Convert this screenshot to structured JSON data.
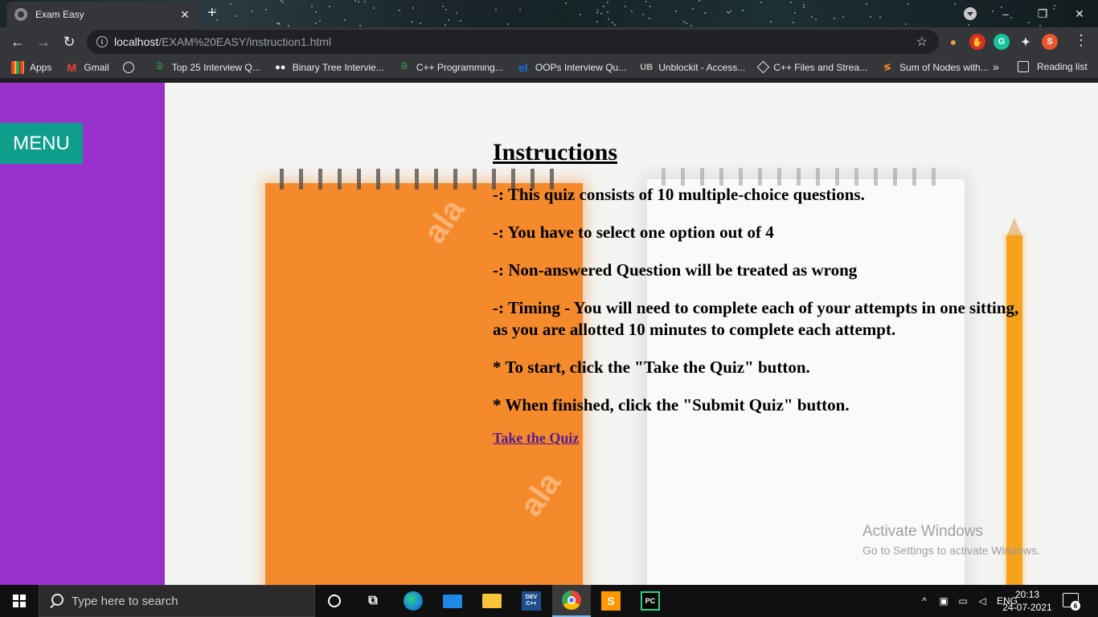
{
  "browser": {
    "tab": {
      "title": "Exam Easy",
      "favicon": "globe-icon"
    },
    "new_tab_label": "+",
    "window_controls": {
      "minimize": "–",
      "maximize": "❐",
      "close": "✕"
    },
    "nav": {
      "back": "←",
      "forward": "→",
      "reload": "↻"
    },
    "address": {
      "host": "localhost",
      "path": "/EXAM%20EASY/instruction1.html"
    },
    "profile_initial": "S",
    "extensions": [
      "G"
    ],
    "bookmarks": [
      {
        "label": "Apps",
        "icon": "apps-grid-icon"
      },
      {
        "label": "Gmail",
        "icon": "gmail-icon"
      },
      {
        "label": "",
        "icon": "globe-icon"
      },
      {
        "label": "Top 25 Interview Q...",
        "icon": "gfg-icon"
      },
      {
        "label": "Binary Tree Intervie...",
        "icon": "medium-icon"
      },
      {
        "label": "C++ Programming...",
        "icon": "gfg-icon"
      },
      {
        "label": "OOPs Interview Qu...",
        "icon": "el-icon"
      },
      {
        "label": "Unblockit - Access...",
        "icon": "ub-icon"
      },
      {
        "label": "C++ Files and Strea...",
        "icon": "tutorialspoint-icon"
      },
      {
        "label": "Sum of Nodes with...",
        "icon": "stackoverflow-icon"
      }
    ],
    "bookmarks_more": "»",
    "reading_list": "Reading list"
  },
  "page": {
    "menu_label": "MENU",
    "title": "Instructions",
    "lines": [
      "-: This quiz consists of 10 multiple-choice questions.",
      "-: You have to select one option out of 4",
      "-: Non-answered Question will be treated as wrong",
      "-: Timing - You will need to complete each of your attempts in one sitting,",
      "as you are allotted 10 minutes to complete each attempt.",
      "* To start, click the \"Take the Quiz\" button.",
      "* When finished, click the \"Submit Quiz\" button."
    ],
    "link_text": "Take the Quiz",
    "watermark": {
      "line1": "Activate Windows",
      "line2": "Go to Settings to activate Windows."
    },
    "colors": {
      "sidebar": "#9932cc",
      "menu_button": "#0f9e8c",
      "link": "#551a8b"
    }
  },
  "taskbar": {
    "search_placeholder": "Type here to search",
    "apps": [
      {
        "name": "cortana-icon",
        "label": ""
      },
      {
        "name": "task-view-icon",
        "label": ""
      },
      {
        "name": "edge-icon",
        "label": ""
      },
      {
        "name": "mail-icon",
        "label": ""
      },
      {
        "name": "file-explorer-icon",
        "label": ""
      },
      {
        "name": "dev-cpp-icon",
        "label": "DEV C++"
      },
      {
        "name": "chrome-icon",
        "label": ""
      },
      {
        "name": "sublime-icon",
        "label": "S"
      },
      {
        "name": "pycharm-icon",
        "label": "PC"
      }
    ],
    "language": "ENG",
    "time": "20:13",
    "date": "24-07-2021",
    "notification_count": "6"
  }
}
